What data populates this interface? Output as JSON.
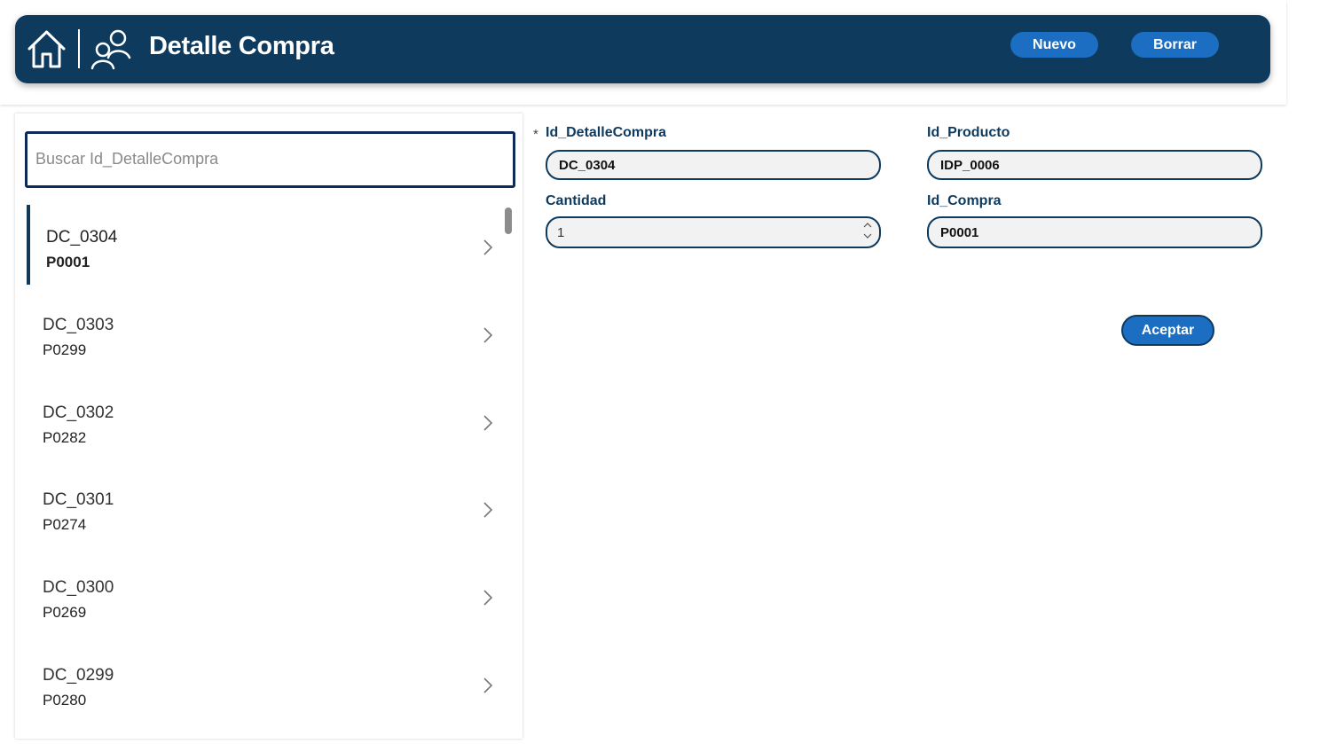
{
  "header": {
    "title": "Detalle Compra",
    "nuevo_label": "Nuevo",
    "borrar_label": "Borrar"
  },
  "search": {
    "placeholder": "Buscar Id_DetalleCompra",
    "value": ""
  },
  "list": {
    "items": [
      {
        "title": "DC_0304",
        "subtitle": "P0001",
        "selected": true
      },
      {
        "title": "DC_0303",
        "subtitle": "P0299",
        "selected": false
      },
      {
        "title": "DC_0302",
        "subtitle": "P0282",
        "selected": false
      },
      {
        "title": "DC_0301",
        "subtitle": "P0274",
        "selected": false
      },
      {
        "title": "DC_0300",
        "subtitle": "P0269",
        "selected": false
      },
      {
        "title": "DC_0299",
        "subtitle": "P0280",
        "selected": false
      }
    ]
  },
  "form": {
    "required_marker": "*",
    "id_detalle": {
      "label": "Id_DetalleCompra",
      "value": "DC_0304"
    },
    "id_producto": {
      "label": "Id_Producto",
      "value": "IDP_0006"
    },
    "cantidad": {
      "label": "Cantidad",
      "value": "1"
    },
    "id_compra": {
      "label": "Id_Compra",
      "value": "P0001"
    },
    "aceptar_label": "Aceptar"
  },
  "icons": {
    "home": "home-icon",
    "people": "people-icon",
    "chevron": "chevron-right-icon"
  },
  "colors": {
    "header_bg": "#0e3a5e",
    "button_bg": "#1b6ec2",
    "accent": "#0e3a5e"
  }
}
